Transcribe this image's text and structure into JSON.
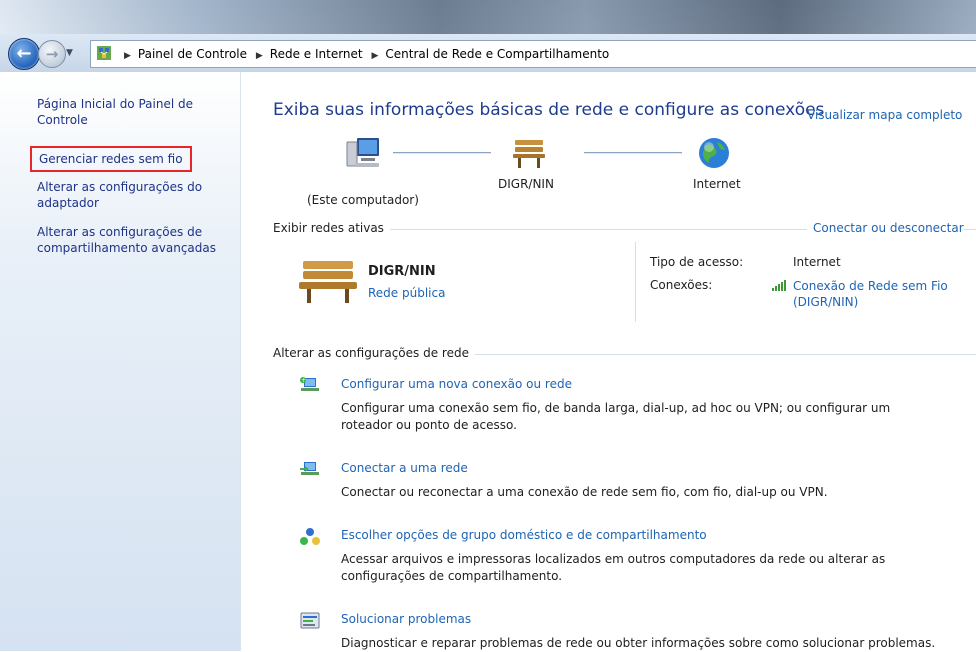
{
  "breadcrumb": {
    "items": [
      "Painel de Controle",
      "Rede e Internet",
      "Central de Rede e Compartilhamento"
    ]
  },
  "icons": {
    "back": "back-arrow-icon",
    "forward": "forward-arrow-icon",
    "location": "network-folder-icon"
  },
  "sidebar": {
    "items": [
      {
        "label": "Página Inicial do Painel de Controle"
      },
      {
        "label": "Gerenciar redes sem fio"
      },
      {
        "label": "Alterar as configurações do adaptador"
      },
      {
        "label": "Alterar as configurações de compartilhamento avançadas"
      }
    ]
  },
  "main": {
    "heading": "Exiba suas informações básicas de rede e configure as conexões",
    "view_map": "Visualizar mapa completo",
    "map": {
      "computer_label": "(Este computador)",
      "network_label": "DIGR/NIN",
      "internet_label": "Internet"
    },
    "active": {
      "section_title": "Exibir redes ativas",
      "connect_link": "Conectar ou desconectar",
      "network_name": "DIGR/NIN",
      "network_type": "Rede pública",
      "access_label": "Tipo de acesso:",
      "access_value": "Internet",
      "connections_label": "Conexões:",
      "connection_link_line1": "Conexão de Rede sem Fio",
      "connection_link_line2": "(DIGR/NIN)"
    },
    "settings": {
      "section_title": "Alterar as configurações de rede",
      "tasks": [
        {
          "title": "Configurar uma nova conexão ou rede",
          "desc": "Configurar uma conexão sem fio, de banda larga, dial-up, ad hoc ou VPN; ou configurar um roteador ou ponto de acesso."
        },
        {
          "title": "Conectar a uma rede",
          "desc": "Conectar ou reconectar a uma conexão de rede sem fio, com fio, dial-up ou VPN."
        },
        {
          "title": "Escolher opções de grupo doméstico e de compartilhamento",
          "desc": "Acessar arquivos e impressoras localizados em outros computadores da rede ou alterar as configurações de compartilhamento."
        },
        {
          "title": "Solucionar problemas",
          "desc": "Diagnosticar e reparar problemas de rede ou obter informações sobre como solucionar problemas."
        }
      ]
    }
  },
  "colors": {
    "link": "#1e64b4",
    "heading": "#1e3c8e",
    "sidebar_link": "#1e3287",
    "highlight_box": "#e8262a"
  }
}
